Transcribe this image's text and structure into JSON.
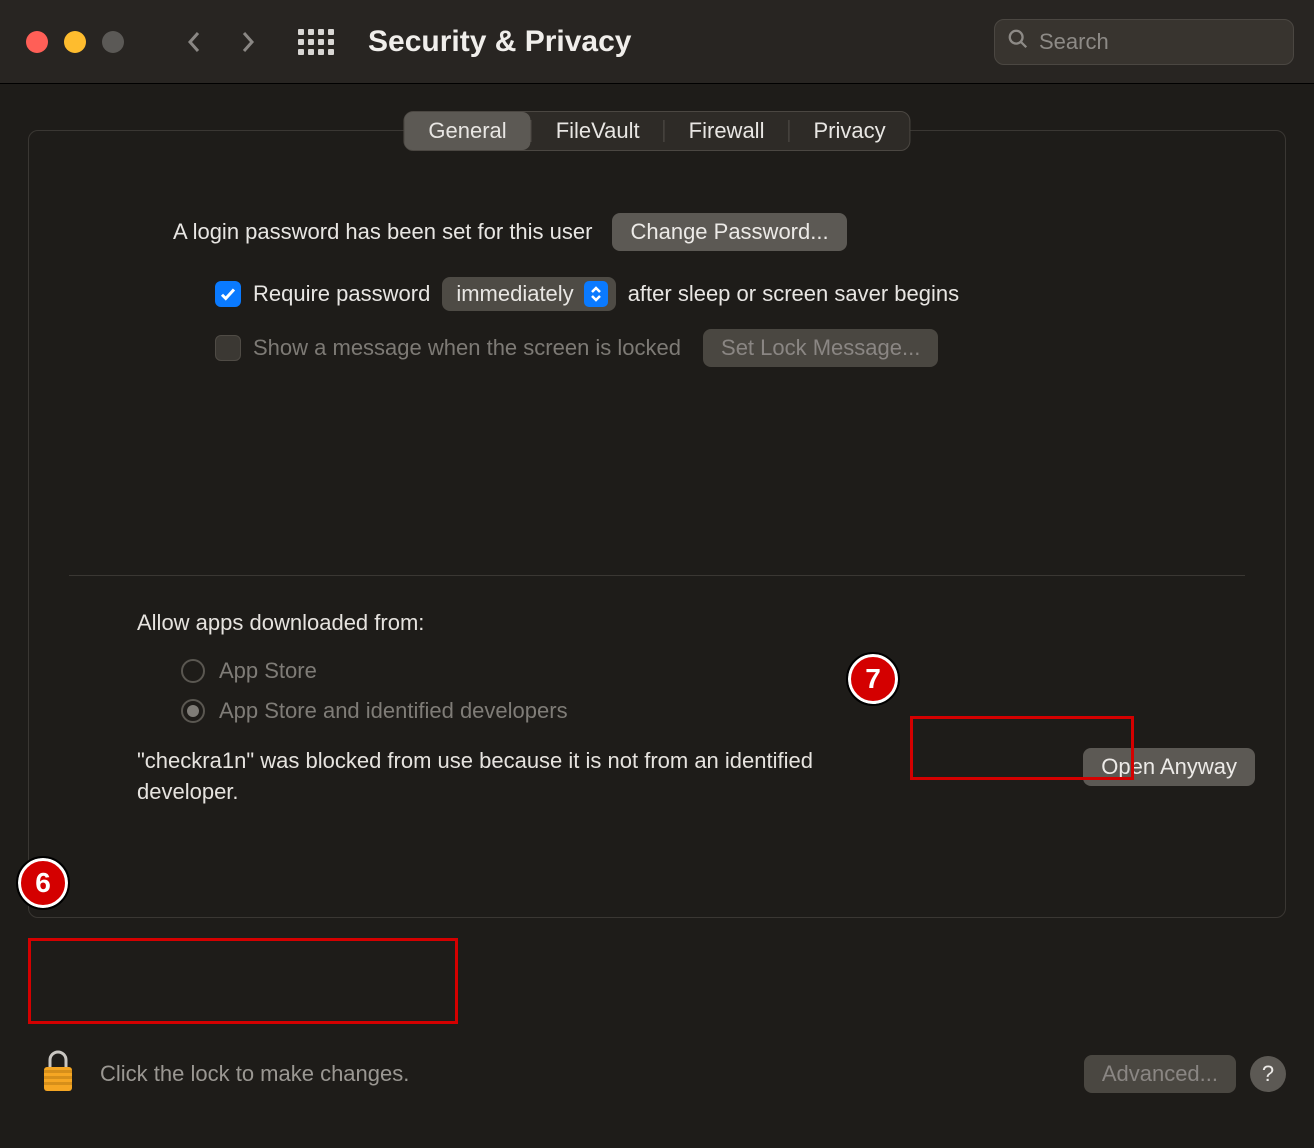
{
  "window": {
    "title": "Security & Privacy",
    "search_placeholder": "Search"
  },
  "tabs": {
    "general": "General",
    "filevault": "FileVault",
    "firewall": "Firewall",
    "privacy": "Privacy"
  },
  "general": {
    "login_password_set": "A login password has been set for this user",
    "change_password": "Change Password...",
    "require_password": "Require password",
    "require_delay": "immediately",
    "after_sleep": "after sleep or screen saver begins",
    "show_message": "Show a message when the screen is locked",
    "set_lock_message": "Set Lock Message..."
  },
  "allow": {
    "heading": "Allow apps downloaded from:",
    "app_store": "App Store",
    "identified": "App Store and identified developers",
    "blocked_message": "\"checkra1n\" was blocked from use because it is not from an identified developer.",
    "open_anyway": "Open Anyway"
  },
  "footer": {
    "lock_hint": "Click the lock to make changes.",
    "advanced": "Advanced...",
    "help": "?"
  },
  "annotations": {
    "six": "6",
    "seven": "7"
  }
}
